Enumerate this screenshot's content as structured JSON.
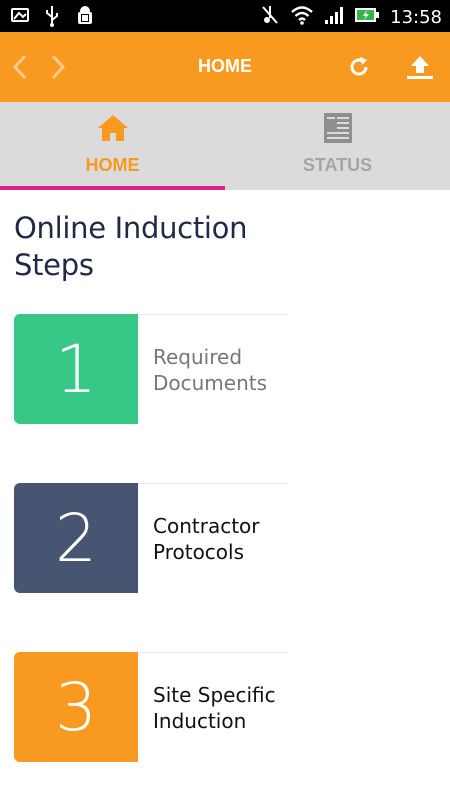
{
  "status_bar": {
    "time": "13:58",
    "icons": [
      "gallery-icon",
      "usb-icon",
      "android-debug-icon",
      "mute-icon",
      "wifi-icon",
      "signal-icon",
      "battery-charging-icon"
    ]
  },
  "app_bar": {
    "title": "HOME",
    "back_icon": "chevron-left-icon",
    "forward_icon": "chevron-right-icon",
    "refresh_icon": "refresh-icon",
    "upload_icon": "upload-icon",
    "background_color": "#f89a1f"
  },
  "tabs": [
    {
      "label": "HOME",
      "icon": "home-icon",
      "active": true
    },
    {
      "label": "STATUS",
      "icon": "document-list-icon",
      "active": false
    }
  ],
  "colors": {
    "accent": "#f89a1f",
    "tab_indicator": "#e0218a"
  },
  "main": {
    "title": "Online Induction Steps",
    "steps": [
      {
        "number": "1",
        "label": "Required Documents",
        "color": "#37c786",
        "label_color": "#777777"
      },
      {
        "number": "2",
        "label": "Contractor Protocols",
        "color": "#475573",
        "label_color": "#111111"
      },
      {
        "number": "3",
        "label": "Site Specific Induction",
        "color": "#f89a1f",
        "label_color": "#111111"
      }
    ]
  }
}
